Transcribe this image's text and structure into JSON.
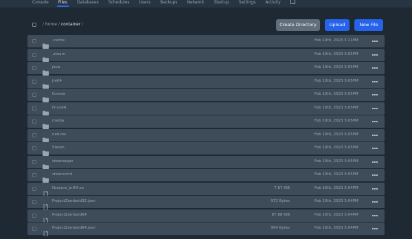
{
  "nav": {
    "tabs": [
      {
        "label": "Console",
        "active": false
      },
      {
        "label": "Files",
        "active": true
      },
      {
        "label": "Databases",
        "active": false
      },
      {
        "label": "Schedules",
        "active": false
      },
      {
        "label": "Users",
        "active": false
      },
      {
        "label": "Backups",
        "active": false
      },
      {
        "label": "Network",
        "active": false
      },
      {
        "label": "Startup",
        "active": false
      },
      {
        "label": "Settings",
        "active": false
      },
      {
        "label": "Activity",
        "active": false
      }
    ],
    "external_icon": "external-link-icon"
  },
  "breadcrumb": {
    "separator": "/",
    "parts": [
      "home",
      "container"
    ]
  },
  "actions": {
    "create_directory": "Create Directory",
    "upload": "Upload",
    "new_file": "New File"
  },
  "colors": {
    "background": "#1f2933",
    "row": "#3e4c59",
    "accent": "#2563eb",
    "secondary_button": "#616e7c",
    "folder_icon": "#9aa5b1"
  },
  "files": [
    {
      "name": ".cache",
      "type": "folder",
      "size": "",
      "modified": "Feb 10th, 2023 5:11PM"
    },
    {
      "name": ".steam",
      "type": "folder",
      "size": "",
      "modified": "Feb 10th, 2023 5:05PM"
    },
    {
      "name": "java",
      "type": "folder",
      "size": "",
      "modified": "Feb 10th, 2023 5:05PM"
    },
    {
      "name": "jre64",
      "type": "folder",
      "size": "",
      "modified": "Feb 10th, 2023 5:05PM"
    },
    {
      "name": "license",
      "type": "folder",
      "size": "",
      "modified": "Feb 10th, 2023 5:05PM"
    },
    {
      "name": "linux64",
      "type": "folder",
      "size": "",
      "modified": "Feb 10th, 2023 5:05PM"
    },
    {
      "name": "media",
      "type": "folder",
      "size": "",
      "modified": "Feb 10th, 2023 5:05PM"
    },
    {
      "name": "natives",
      "type": "folder",
      "size": "",
      "modified": "Feb 10th, 2023 5:05PM"
    },
    {
      "name": "Steam",
      "type": "folder",
      "size": "",
      "modified": "Feb 10th, 2023 5:05PM"
    },
    {
      "name": "steamapps",
      "type": "folder",
      "size": "",
      "modified": "Feb 10th, 2023 5:05PM"
    },
    {
      "name": "steamcmd",
      "type": "folder",
      "size": "",
      "modified": "Feb 10th, 2023 5:05PM"
    },
    {
      "name": "libzeere_jni64.so",
      "type": "file",
      "size": "7.87 KiB",
      "modified": "Feb 10th, 2023 5:04PM"
    },
    {
      "name": "ProjectZomboid32.json",
      "type": "file",
      "size": "972 Bytes",
      "modified": "Feb 10th, 2023 5:04PM"
    },
    {
      "name": "ProjectZomboid64",
      "type": "file",
      "size": "87.88 KiB",
      "modified": "Feb 10th, 2023 5:04PM"
    },
    {
      "name": "ProjectZomboid64.json",
      "type": "file",
      "size": "954 Bytes",
      "modified": "Feb 10th, 2023 5:04PM"
    }
  ]
}
